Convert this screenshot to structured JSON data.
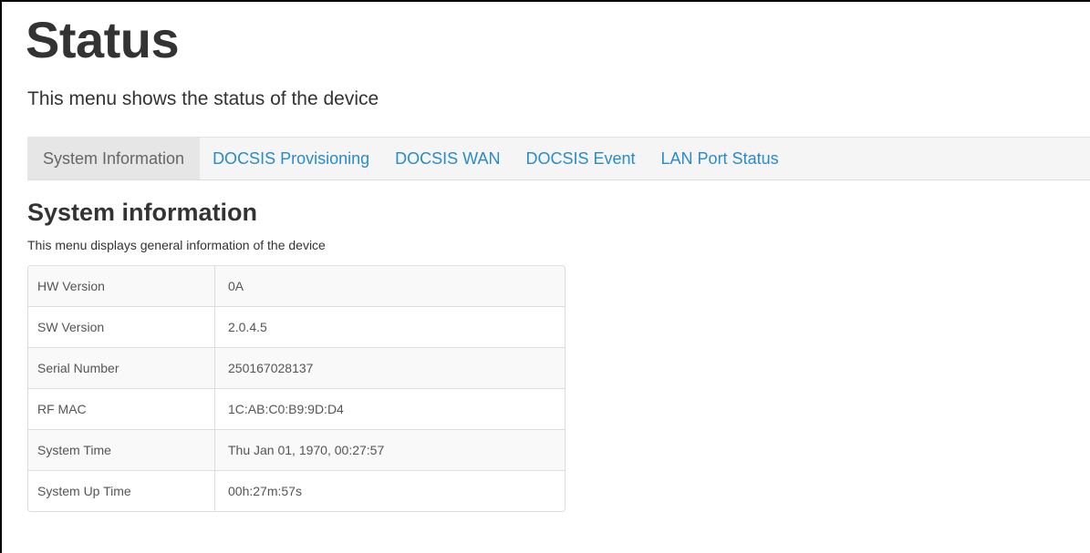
{
  "header": {
    "title": "Status",
    "description": "This menu shows the status of the device"
  },
  "tabs": [
    {
      "label": "System Information",
      "active": true
    },
    {
      "label": "DOCSIS Provisioning",
      "active": false
    },
    {
      "label": "DOCSIS WAN",
      "active": false
    },
    {
      "label": "DOCSIS Event",
      "active": false
    },
    {
      "label": "LAN Port Status",
      "active": false
    }
  ],
  "section": {
    "title": "System information",
    "description": "This menu displays general information of the device"
  },
  "system_info": [
    {
      "label": "HW Version",
      "value": "0A"
    },
    {
      "label": "SW Version",
      "value": "2.0.4.5"
    },
    {
      "label": "Serial Number",
      "value": "250167028137"
    },
    {
      "label": "RF MAC",
      "value": "1C:AB:C0:B9:9D:D4"
    },
    {
      "label": "System Time",
      "value": "Thu Jan 01, 1970, 00:27:57"
    },
    {
      "label": "System Up Time",
      "value": "00h:27m:57s"
    }
  ],
  "colors": {
    "link": "#2a8bc9",
    "active_tab_bg": "#e6e6e6",
    "tabbar_bg": "#f5f5f5",
    "text": "#333333"
  }
}
